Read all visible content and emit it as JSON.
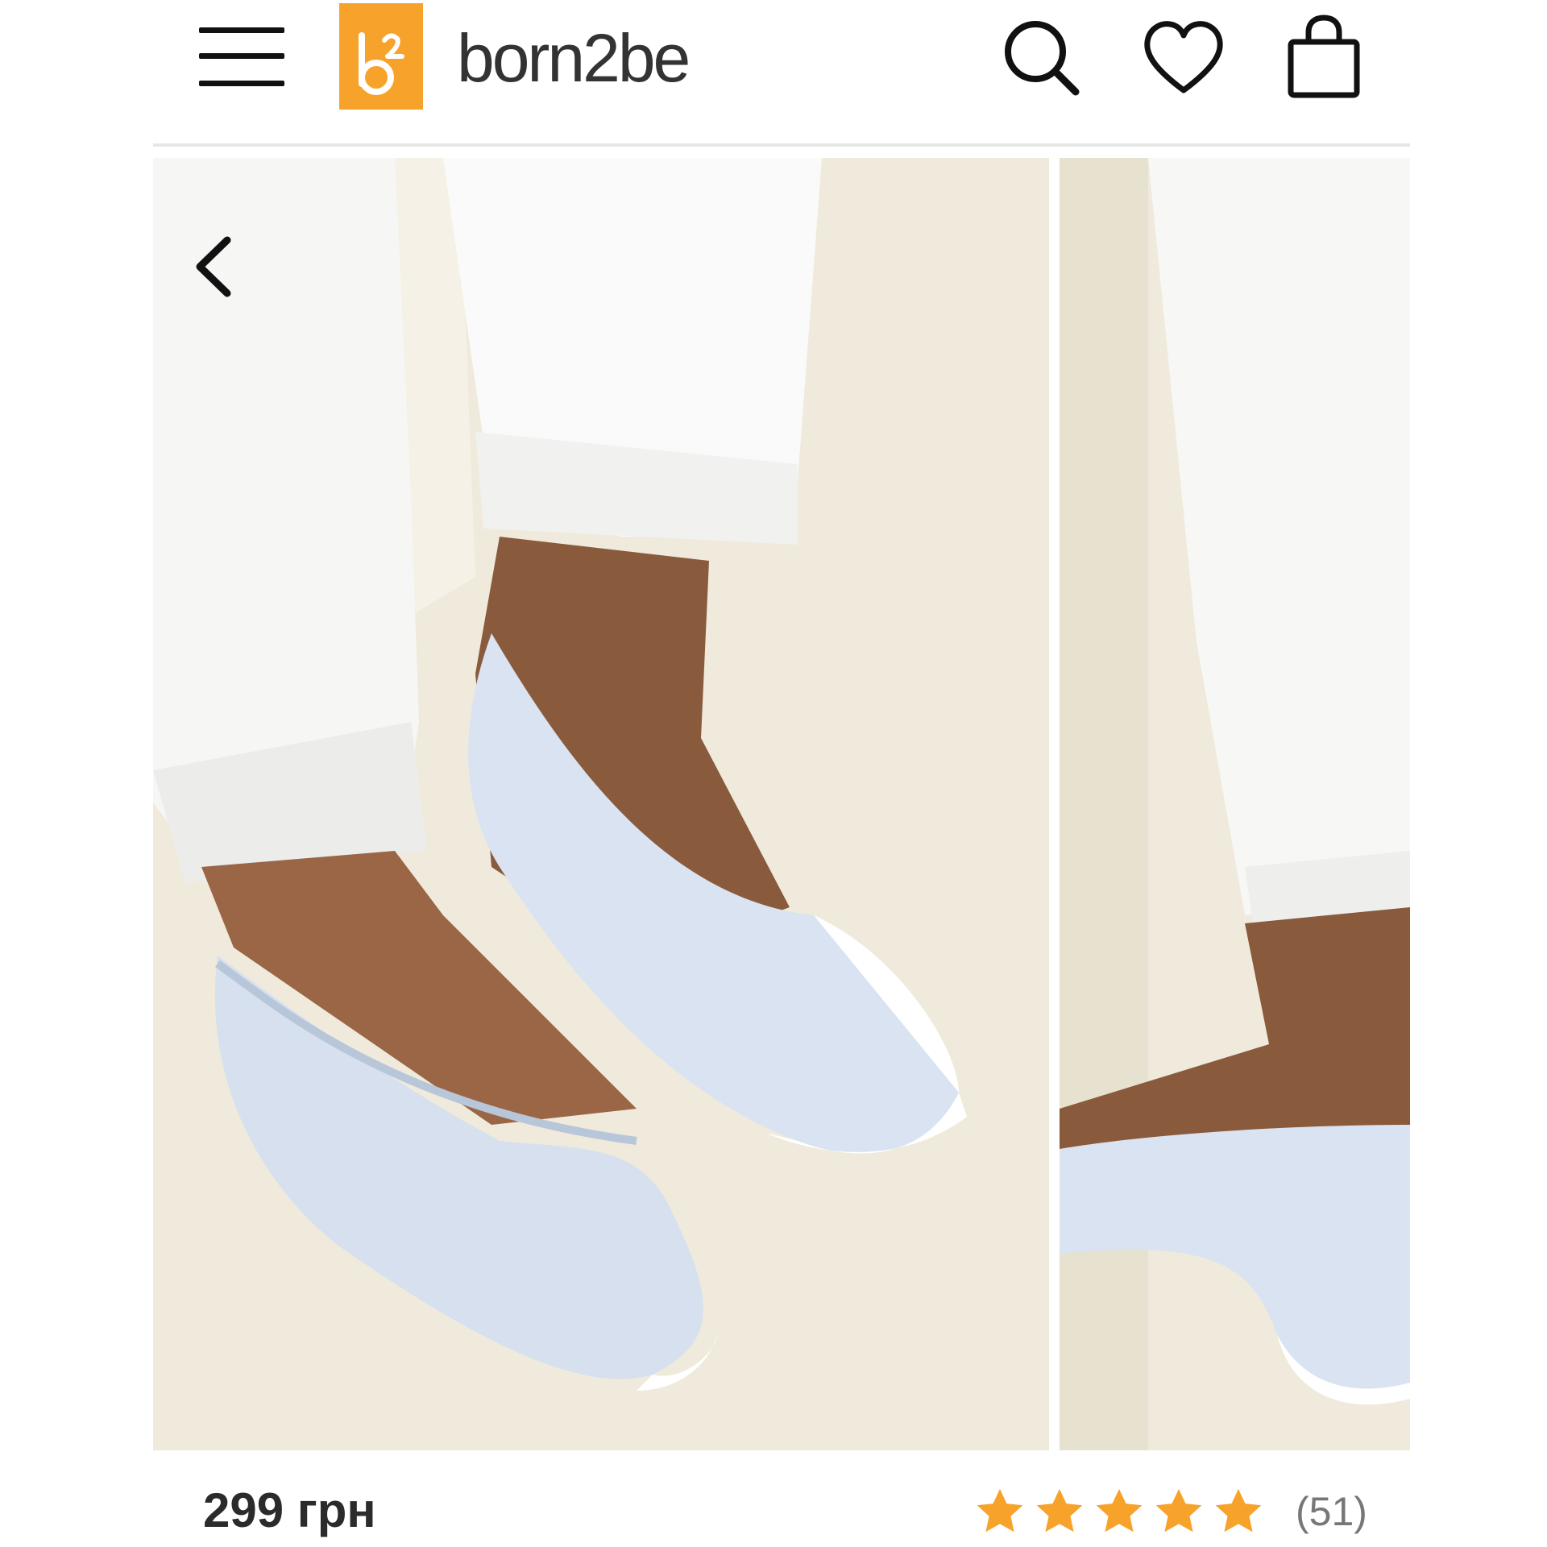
{
  "header": {
    "logo_mark": "b²",
    "logo_text": "born2be",
    "icons": [
      "menu-icon",
      "search-icon",
      "heart-icon",
      "shopping-bag-icon"
    ]
  },
  "gallery": {
    "prev_icon": "chevron-left-icon",
    "slides": 2
  },
  "product": {
    "price": "299 грн",
    "rating_stars": 5,
    "review_count": "(51)"
  },
  "colors": {
    "brand": "#f7a32b",
    "star": "#f7a32b",
    "price_text": "#2b2b2b"
  }
}
